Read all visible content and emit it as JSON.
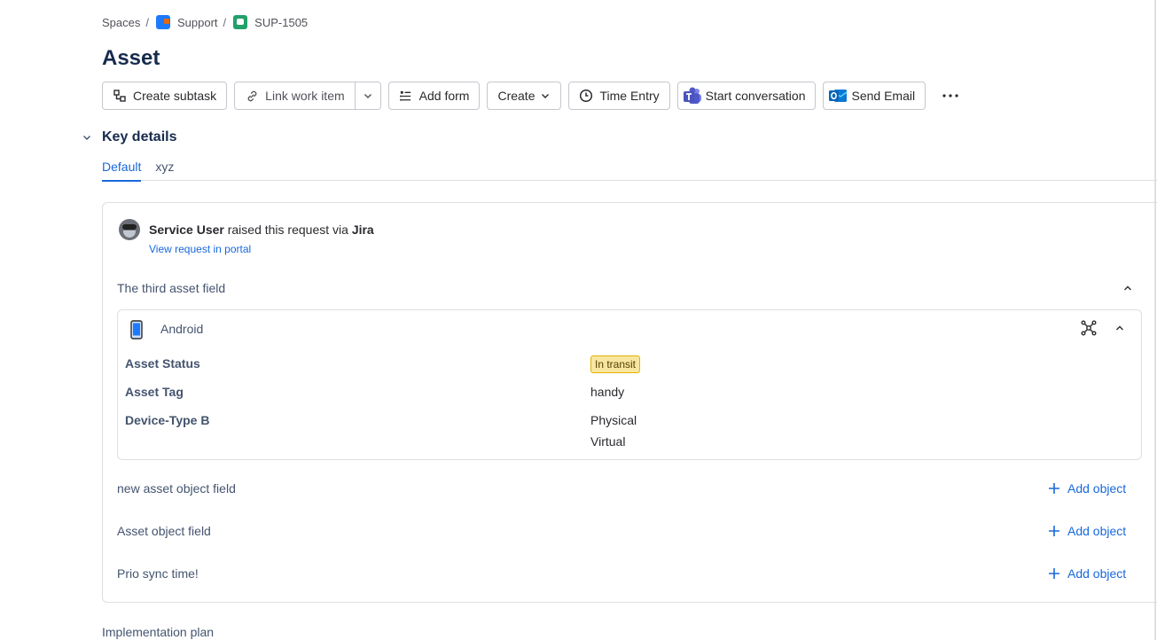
{
  "breadcrumb": {
    "spaces": "Spaces",
    "project": "Support",
    "issue_key": "SUP-1505",
    "separator": "/"
  },
  "page": {
    "title": "Asset"
  },
  "toolbar": {
    "create_subtask": "Create subtask",
    "link_work_item": "Link work item",
    "add_form": "Add form",
    "create": "Create",
    "time_entry": "Time Entry",
    "start_conversation": "Start conversation",
    "send_email": "Send Email"
  },
  "key_details": {
    "heading": "Key details",
    "tabs": [
      "Default",
      "xyz"
    ]
  },
  "request": {
    "user": "Service User",
    "middle": " raised this request via ",
    "channel": "Jira",
    "portal_link": "View request in portal"
  },
  "fields": {
    "third_asset": "The third asset field",
    "new_asset_object": "new asset object field",
    "asset_object": "Asset object field",
    "prio_sync": "Prio sync time!",
    "add_object": "Add object"
  },
  "asset": {
    "name": "Android",
    "attributes": [
      {
        "label": "Asset Status",
        "value": "In transit"
      },
      {
        "label": "Asset Tag",
        "value": "handy"
      },
      {
        "label": "Device-Type B",
        "values": [
          "Physical",
          "Virtual"
        ]
      }
    ],
    "status_color": "#f8e6a0"
  },
  "footer": {
    "next_section": "Implementation plan"
  },
  "colors": {
    "link": "#1868db",
    "border": "#dcdfe4",
    "title": "#172b4d"
  },
  "icons": [
    "subtask-icon",
    "link-icon",
    "form-icon",
    "clock-icon",
    "teams-icon",
    "outlook-icon",
    "more-icon",
    "phone-icon",
    "graph-icon",
    "plus-icon",
    "chevron-up-icon",
    "chevron-down-icon"
  ]
}
